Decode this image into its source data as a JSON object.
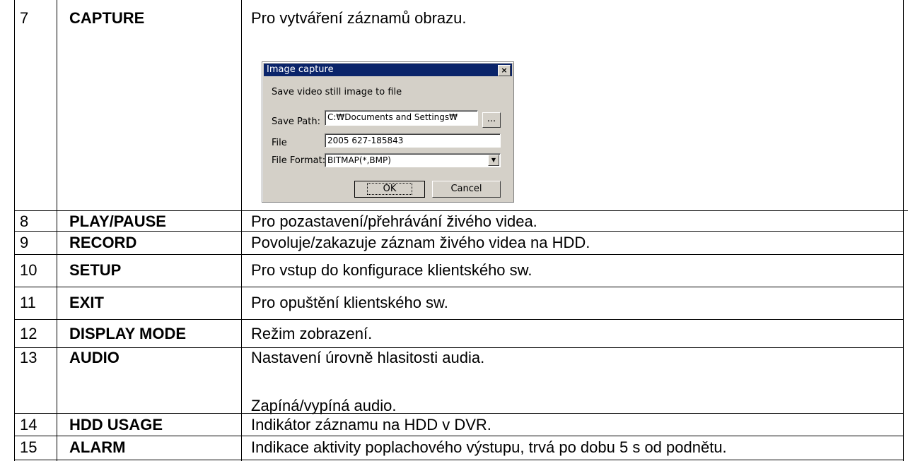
{
  "rows": [
    {
      "num": "7",
      "name": "CAPTURE",
      "desc": "Pro vytváření záznamů obrazu."
    },
    {
      "num": "8",
      "name": "PLAY/PAUSE",
      "desc": "Pro pozastavení/přehrávání živého videa."
    },
    {
      "num": "9",
      "name": "RECORD",
      "desc": "Povoluje/zakazuje záznam živého videa na HDD."
    },
    {
      "num": "10",
      "name": "SETUP",
      "desc": "Pro vstup do konfigurace klientského sw."
    },
    {
      "num": "11",
      "name": "EXIT",
      "desc": "Pro opuštění klientského sw."
    },
    {
      "num": "12",
      "name": "DISPLAY MODE",
      "desc": "Režim zobrazení."
    },
    {
      "num": "13",
      "name": "AUDIO",
      "desc": "Nastavení úrovně hlasitosti audia.",
      "desc2": "Zapíná/vypíná audio."
    },
    {
      "num": "14",
      "name": "HDD USAGE",
      "desc": "Indikátor záznamu na HDD v DVR."
    },
    {
      "num": "15",
      "name": "ALARM",
      "desc": "Indikace aktivity poplachového výstupu, trvá po dobu 5 s od podnětu."
    }
  ],
  "dialog": {
    "title": "Image capture",
    "close_glyph": "×",
    "message": "Save video still image to file",
    "save_path_label": "Save Path:",
    "save_path_value": "C:₩Documents and Settings₩",
    "browse_label": "...",
    "file_label": "File",
    "file_value": "2005 627-185843",
    "format_label": "File Format:",
    "format_value": "BITMAP(*,BMP)",
    "ok_label": "OK",
    "cancel_label": "Cancel"
  }
}
